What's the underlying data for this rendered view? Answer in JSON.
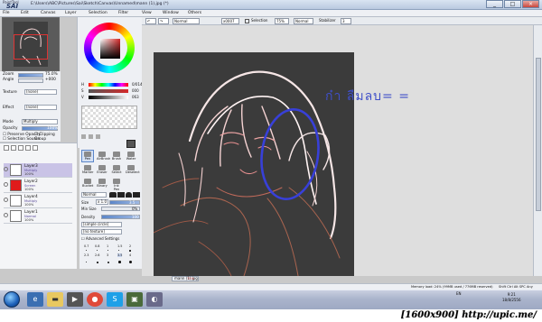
{
  "app": {
    "logo_top": "PaintTool",
    "logo_main": "SAI",
    "title": "E:\\Users\\ABC\\Pictures\\Sai\\Sketch\\Canvas\\Unnamed\\mann (1).jpg (*)"
  },
  "menu": [
    "File",
    "Edit",
    "Canvas",
    "Layer",
    "Selection",
    "Filter",
    "View",
    "Window",
    "Others"
  ],
  "window_buttons": [
    "_",
    "□",
    "×"
  ],
  "toolbar": {
    "flip_mode": "Normal",
    "zoom": "x0007",
    "selection_label": "Selection",
    "selection_value": "75%",
    "blend": "Normal",
    "stabilizer_label": "Stabilizer",
    "stabilizer_value": "3"
  },
  "navigator": {
    "zoom_label": "Zoom",
    "zoom_value": "75.0%",
    "angle_label": "Angle",
    "angle_value": "+000"
  },
  "left_props": {
    "texture_label": "Texture",
    "texture_value": "(none)",
    "effect_label": "Effect",
    "effect_value": "(none)",
    "mode_label": "Mode",
    "mode_value": "Multiply",
    "opacity_label": "Opacity",
    "opacity_value": "100%",
    "preserve_opacity": "Preserve Opacity",
    "clipping_group": "Clipping Group",
    "selection_source": "Selection Source"
  },
  "layers": [
    {
      "name": "Layer3",
      "mode": "Multiply",
      "opacity": "100%",
      "selected": true,
      "thumb": "#ffffff"
    },
    {
      "name": "Layer2",
      "mode": "Screen",
      "opacity": "100%",
      "selected": false,
      "thumb": "#e01b1b"
    },
    {
      "name": "Layer4",
      "mode": "Multiply",
      "opacity": "100%",
      "selected": false,
      "thumb": "#ffffff"
    },
    {
      "name": "Layer1",
      "mode": "Normal",
      "opacity": "100%",
      "selected": false,
      "thumb": "#ffffff"
    }
  ],
  "color": {
    "h_label": "H",
    "h_value": "000",
    "s_label": "S",
    "s_value": "000",
    "v_label": "V",
    "v_value": "063",
    "r_label": "R",
    "r_value": "0/014",
    "fg": "#555555",
    "accent": "#d52a2a"
  },
  "tools": {
    "row1": [
      "Pen",
      "AirBrush",
      "Brush",
      "Water"
    ],
    "row2": [
      "Marker",
      "Eraser",
      "Select",
      "Deselect"
    ],
    "row3": [
      "Bucket",
      "Binary",
      "Ink Pen",
      ""
    ],
    "size_label": "Size",
    "size_mult": "x 1.0",
    "size_value": "3.5",
    "min_size_label": "Min Size",
    "min_size_value": "0%",
    "density_label": "Density",
    "density_value": "100",
    "shape": "[simple circle]",
    "texture": "[no texture]",
    "advanced": "Advanced Settings",
    "blend_mode": "Normal",
    "brush_sizes": [
      "0.7",
      "0.8",
      "1",
      "1.5",
      "2",
      "2.3",
      "2.6",
      "3",
      "3.5",
      "4"
    ]
  },
  "canvas": {
    "handwritten_note": "ก๋า ลืมลบ= ="
  },
  "canvas_tab": {
    "name": "mann (1).jpg",
    "zoom": "75%"
  },
  "status": {
    "memory": "Memory load: 24% (99MB used / 776MB reserved)",
    "keys": "Shift Ctrl Alt SPC Any"
  },
  "taskbar": {
    "lang": "EN",
    "time": "9:21",
    "date": "18/8/2556"
  },
  "footer": {
    "watermark": "[1600x900] http://upic.me/"
  }
}
